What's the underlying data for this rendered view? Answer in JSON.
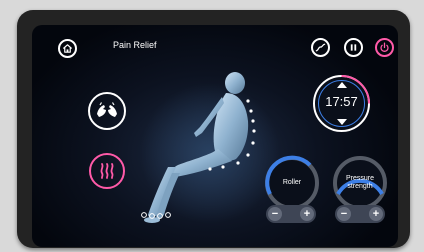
{
  "header": {
    "title": "Pain  Relief",
    "icons": [
      "home-icon",
      "trend-icon",
      "pause-icon",
      "power-icon"
    ]
  },
  "modes": {
    "massage_icon": "hands-icon",
    "heat_icon": "heat-icon"
  },
  "timer": {
    "value": "17:57"
  },
  "controls": {
    "roller": {
      "label": "Roller"
    },
    "pressure": {
      "label_line1": "Pressure",
      "label_line2": "strength"
    }
  },
  "colors": {
    "power": "#ff5aa8",
    "heat": "#ff5aa8",
    "knob_accent": "#3d7fe6",
    "screen_bg": "#0c1220"
  }
}
